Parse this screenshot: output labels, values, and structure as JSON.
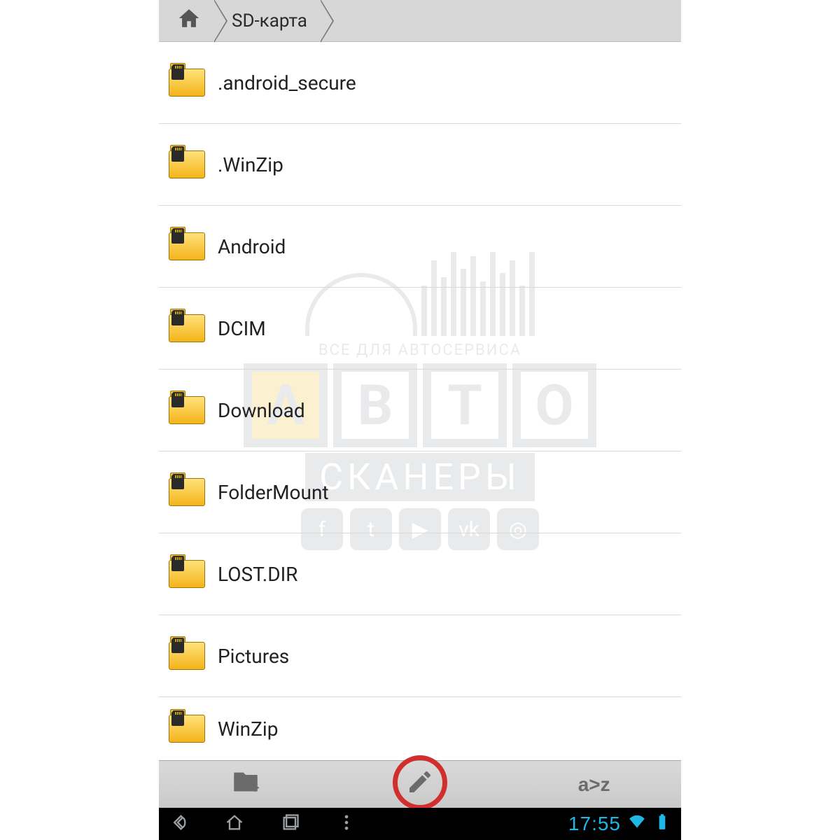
{
  "breadcrumb": {
    "home_icon": "home-icon",
    "current": "SD-карта"
  },
  "folders": [
    {
      "name": ".android_secure"
    },
    {
      "name": ".WinZip"
    },
    {
      "name": "Android"
    },
    {
      "name": "DCIM"
    },
    {
      "name": "Download"
    },
    {
      "name": "FolderMount"
    },
    {
      "name": "LOST.DIR"
    },
    {
      "name": "Pictures"
    },
    {
      "name": "WinZip"
    }
  ],
  "actionbar": {
    "new_folder": "new-folder",
    "edit": "edit",
    "sort": "a>z"
  },
  "statusbar": {
    "time": "17:55"
  },
  "watermark": {
    "line1": "ВСЕ ДЛЯ АВТОСЕРВИСА",
    "line2": "АВТО",
    "line3": "СКАНЕРЫ"
  }
}
